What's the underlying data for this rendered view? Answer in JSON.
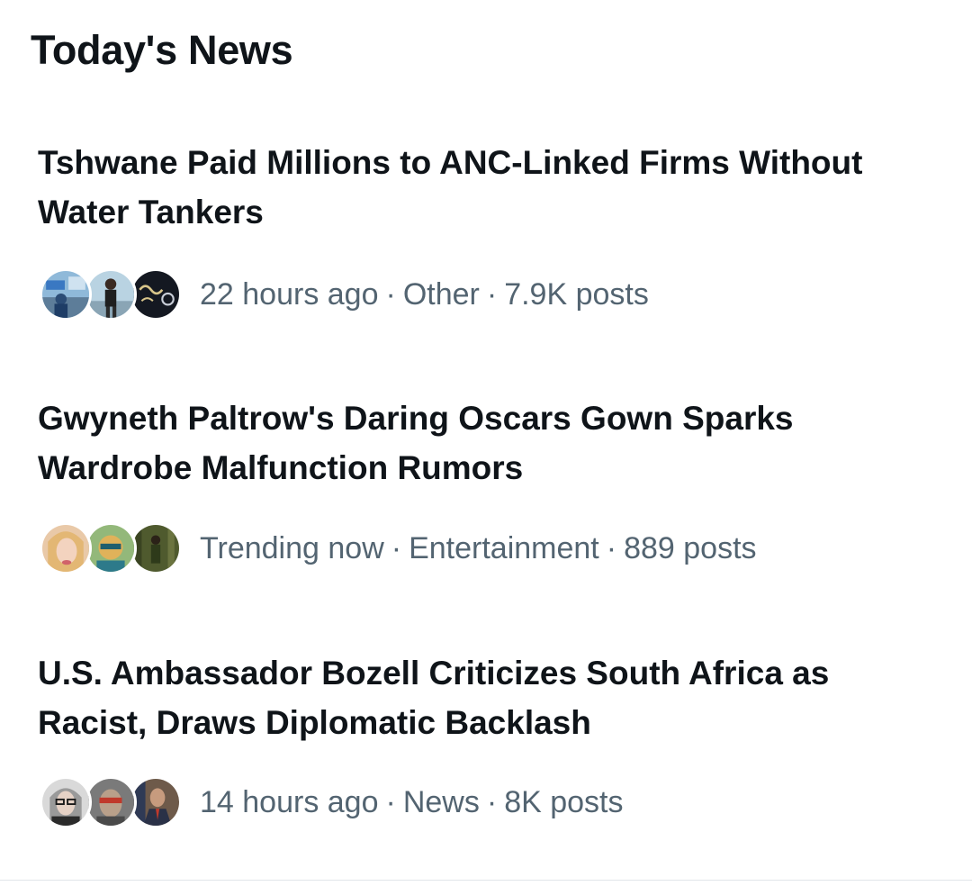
{
  "section": {
    "title": "Today's News"
  },
  "separator": "·",
  "news": [
    {
      "headline": "Tshwane Paid Millions to ANC-Linked Firms Without Water Tankers",
      "time": "22 hours ago",
      "category": "Other",
      "posts": "7.9K posts",
      "avatars": [
        "street-scene-avatar",
        "runner-avatar",
        "logo-avatar"
      ]
    },
    {
      "headline": "Gwyneth Paltrow's Daring Oscars Gown Sparks Wardrobe Malfunction Rumors",
      "time": "Trending now",
      "category": "Entertainment",
      "posts": "889 posts",
      "avatars": [
        "woman-portrait-avatar",
        "cartoon-avatar",
        "forest-figure-avatar"
      ]
    },
    {
      "headline": "U.S. Ambassador Bozell Criticizes South Africa as Racist, Draws Diplomatic Backlash",
      "time": "14 hours ago",
      "category": "News",
      "posts": "8K posts",
      "avatars": [
        "glasses-woman-avatar",
        "masked-man-avatar",
        "suit-man-avatar"
      ]
    }
  ]
}
